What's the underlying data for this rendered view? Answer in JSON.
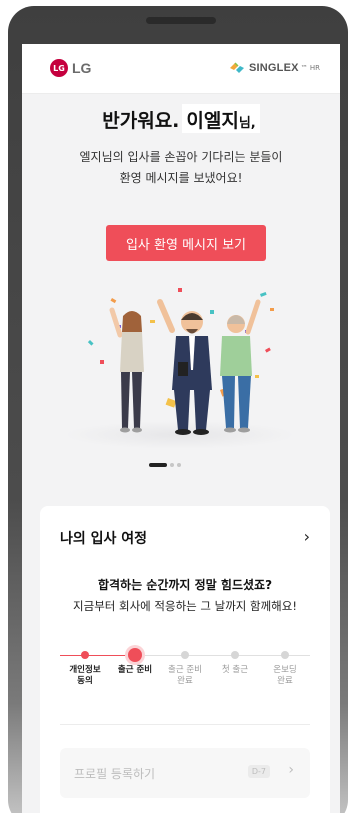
{
  "header": {
    "lg_logo_text": "LG",
    "lg_logo_mark": "LG",
    "singlex_text": "SINGLEX",
    "singlex_sub": "™ HR"
  },
  "welcome": {
    "greeting": "반가워요.",
    "name": "이엘지",
    "name_suffix": "님,",
    "message_line1": "엘지님의 입사를 손꼽아 기다리는 분들이",
    "message_line2": "환영 메시지를 보냈어요!"
  },
  "cta": {
    "label": "입사 환영 메시지 보기"
  },
  "carousel": {
    "total_pages": 3,
    "active_page": 1
  },
  "journey": {
    "title": "나의 입사 여정",
    "arrow": "›",
    "headline": "합격하는 순간까지 정말 힘드셨죠?",
    "subline": "지금부터 회사에 적응하는 그 날까지 함께해요!",
    "steps": [
      {
        "label_line1": "개인정보",
        "label_line2": "동의",
        "state": "done"
      },
      {
        "label_line1": "출근 준비",
        "label_line2": "",
        "state": "current"
      },
      {
        "label_line1": "출근 준비",
        "label_line2": "완료",
        "state": "pending"
      },
      {
        "label_line1": "첫 출근",
        "label_line2": "",
        "state": "pending"
      },
      {
        "label_line1": "온보딩",
        "label_line2": "완료",
        "state": "pending"
      }
    ],
    "task": {
      "label": "프로필 등록하기",
      "badge": "D-7",
      "arrow": "›"
    }
  },
  "colors": {
    "accent": "#ef4e59",
    "lg_brand": "#c5003e",
    "background": "#f3f3f4"
  },
  "icons": {
    "lg_logo": "lg-logo-icon",
    "singlex_logo": "singlex-logo-icon",
    "chevron": "chevron-right-icon"
  }
}
